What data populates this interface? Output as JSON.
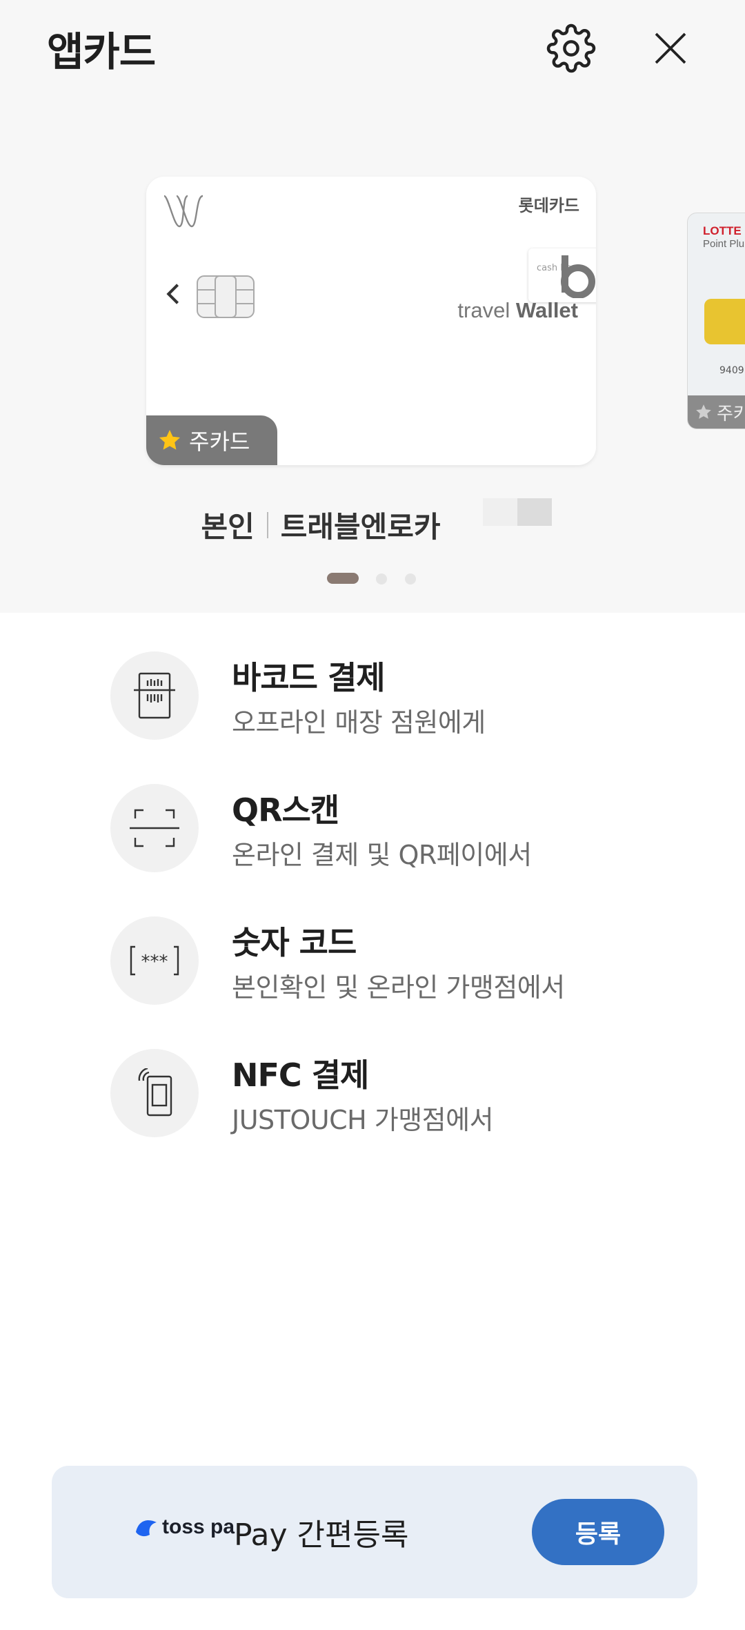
{
  "header": {
    "title": "앱카드"
  },
  "card": {
    "brand": "롯데카드",
    "cashbee_text": "cash bee",
    "travel_prefix": "travel",
    "travel_bold": "Wallet",
    "main_badge": "주카드",
    "owner": "본인",
    "name": "트래블엔로카"
  },
  "card2": {
    "brand": "LOTTE",
    "sub": "Point Plu",
    "number": "9409",
    "badge": "주카"
  },
  "pagination": {
    "count": 3,
    "active": 0
  },
  "menu": [
    {
      "title": "바코드 결제",
      "desc": "오프라인 매장 점원에게",
      "icon": "barcode-icon"
    },
    {
      "title": "QR스캔",
      "desc": "온라인 결제 및 QR페이에서",
      "icon": "qr-scan-icon"
    },
    {
      "title": "숫자 코드",
      "desc": "본인확인 및 온라인 가맹점에서",
      "icon": "number-code-icon"
    },
    {
      "title": "NFC 결제",
      "desc": "JUSTOUCH 가맹점에서",
      "icon": "nfc-icon"
    }
  ],
  "toss": {
    "logo_text": "toss pa",
    "label": "Pay 간편등록",
    "button": "등록"
  },
  "colors": {
    "accent": "#3371c4",
    "badge": "#797979",
    "active_dot": "#8a7a72"
  }
}
